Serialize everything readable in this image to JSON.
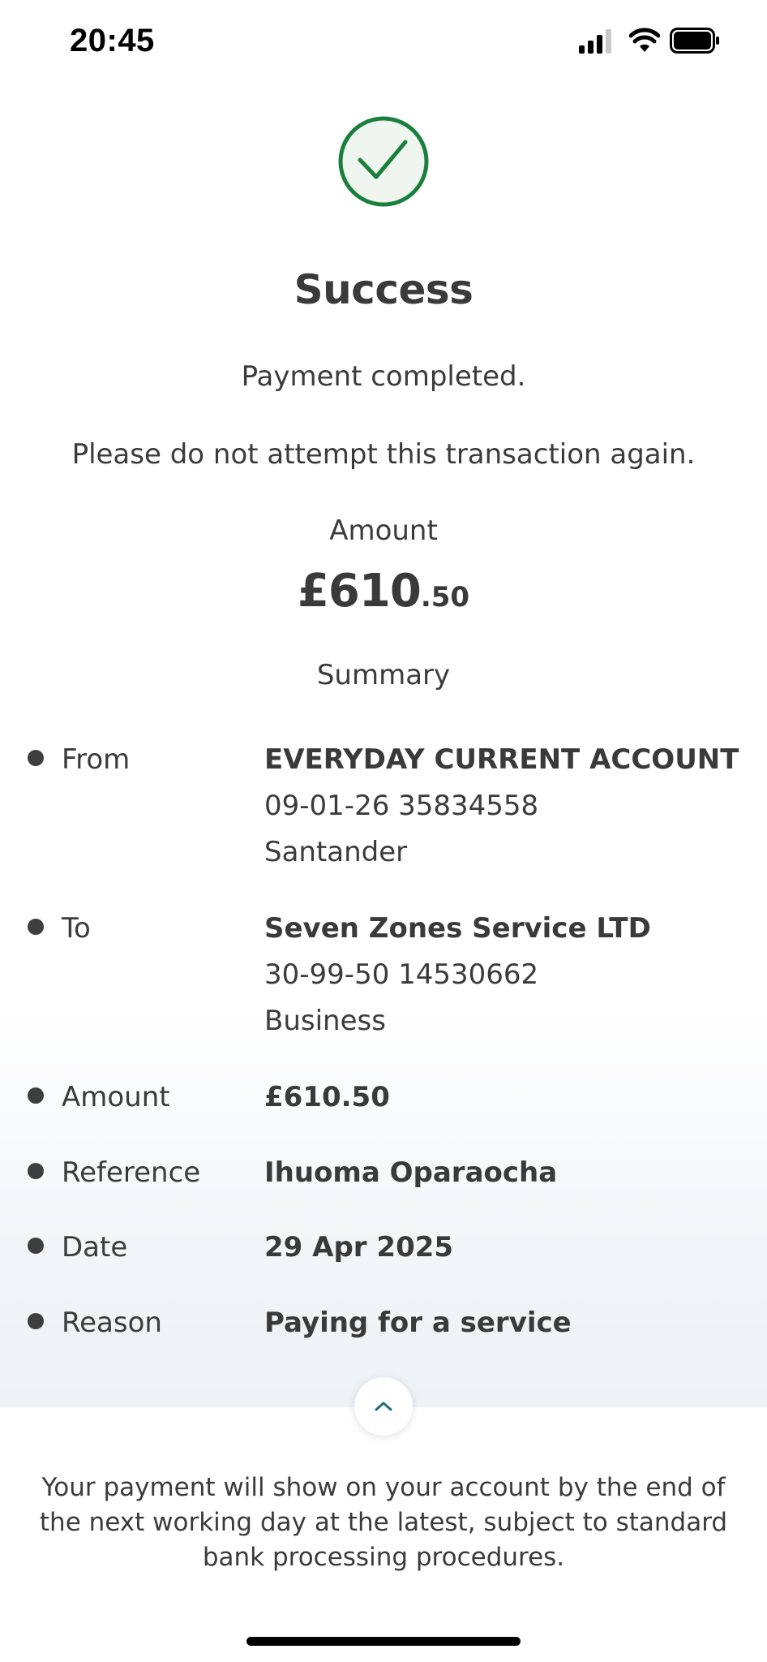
{
  "status_bar": {
    "time": "20:45"
  },
  "header": {
    "title": "Success",
    "line1": "Payment completed.",
    "line2": "Please do not attempt this transaction again.",
    "amount_label": "Amount",
    "amount_pounds": "£610",
    "amount_pence": ".50",
    "summary_label": "Summary",
    "accent_color": "#1a7f3c"
  },
  "summary": {
    "from": {
      "label": "From",
      "name": "EVERYDAY CURRENT ACCOUNT",
      "account": "09-01-26 35834558",
      "bank": "Santander"
    },
    "to": {
      "label": "To",
      "name": "Seven Zones Service LTD",
      "account": "30-99-50 14530662",
      "type": "Business"
    },
    "amount": {
      "label": "Amount",
      "value": "£610.50"
    },
    "reference": {
      "label": "Reference",
      "value": "Ihuoma Oparaocha"
    },
    "date": {
      "label": "Date",
      "value": "29 Apr 2025"
    },
    "reason": {
      "label": "Reason",
      "value": "Paying for a service"
    }
  },
  "collapse_button": {
    "icon": "chevron-up-icon"
  },
  "footer": {
    "note": "Your payment will show on your account by the end of the next working day at the latest, subject to standard bank processing procedures."
  }
}
